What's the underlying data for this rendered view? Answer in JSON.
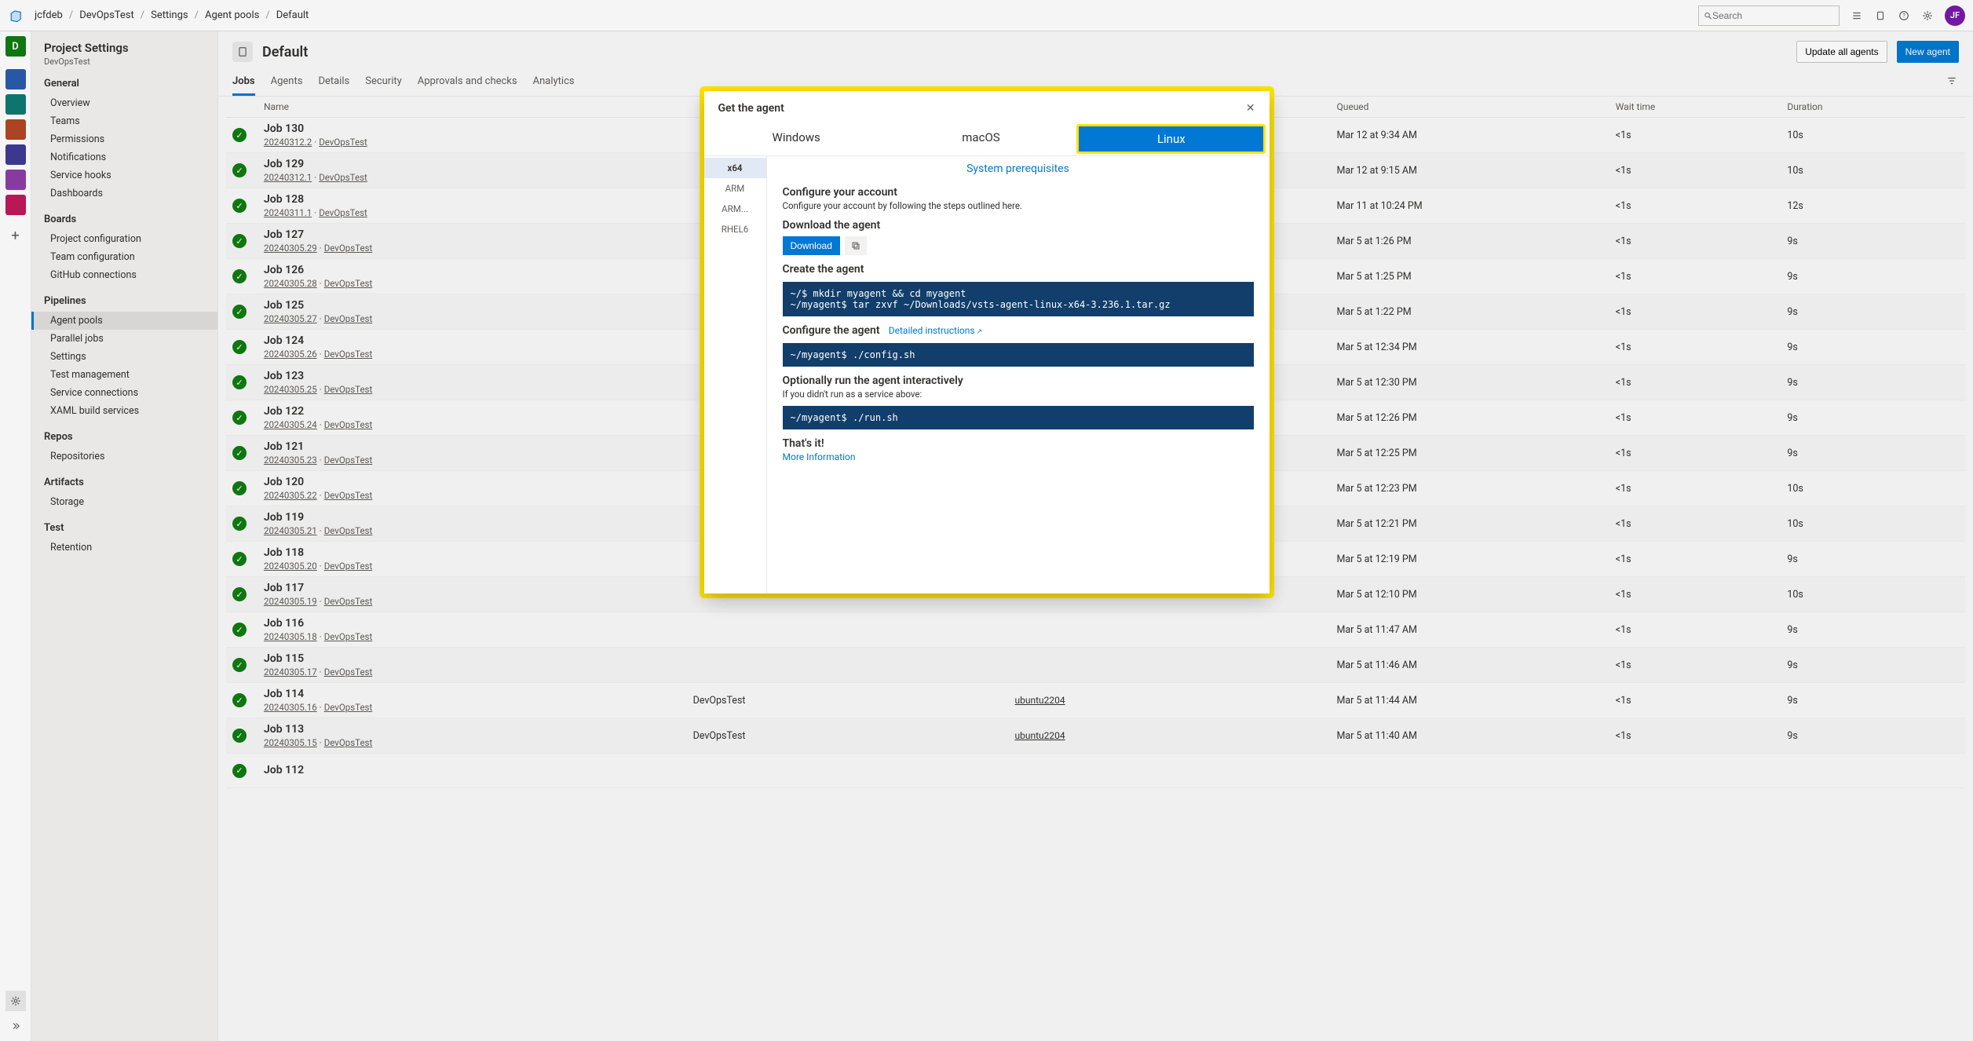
{
  "breadcrumbs": [
    "jcfdeb",
    "DevOpsTest",
    "Settings",
    "Agent pools",
    "Default"
  ],
  "search_placeholder": "Search",
  "avatar_initials": "JF",
  "left_rail_icons": [
    {
      "label": "D",
      "color": "#107c10"
    },
    {
      "label": "",
      "color": "#2a5caa"
    },
    {
      "label": "",
      "color": "#0e7a73"
    },
    {
      "label": "",
      "color": "#b24726"
    },
    {
      "label": "",
      "color": "#3f3b94"
    },
    {
      "label": "",
      "color": "#8e3ea6"
    },
    {
      "label": "",
      "color": "#c2185b"
    }
  ],
  "project_settings_title": "Project Settings",
  "project_settings_sub": "DevOpsTest",
  "sidebar_groups": [
    {
      "label": "General",
      "items": [
        {
          "label": "Overview"
        },
        {
          "label": "Teams"
        },
        {
          "label": "Permissions"
        },
        {
          "label": "Notifications"
        },
        {
          "label": "Service hooks"
        },
        {
          "label": "Dashboards"
        }
      ]
    },
    {
      "label": "Boards",
      "items": [
        {
          "label": "Project configuration"
        },
        {
          "label": "Team configuration"
        },
        {
          "label": "GitHub connections"
        }
      ]
    },
    {
      "label": "Pipelines",
      "items": [
        {
          "label": "Agent pools",
          "active": true
        },
        {
          "label": "Parallel jobs"
        },
        {
          "label": "Settings"
        },
        {
          "label": "Test management"
        },
        {
          "label": "Service connections"
        },
        {
          "label": "XAML build services"
        }
      ]
    },
    {
      "label": "Repos",
      "items": [
        {
          "label": "Repositories"
        }
      ]
    },
    {
      "label": "Artifacts",
      "items": [
        {
          "label": "Storage"
        }
      ]
    },
    {
      "label": "Test",
      "items": [
        {
          "label": "Retention"
        }
      ]
    }
  ],
  "pool_name": "Default",
  "buttons": {
    "update_all": "Update all agents",
    "new_agent": "New agent"
  },
  "tabs": [
    "Jobs",
    "Agents",
    "Details",
    "Security",
    "Approvals and checks",
    "Analytics"
  ],
  "active_tab": "Jobs",
  "columns": [
    "",
    "Name",
    "",
    "",
    "Queued",
    "Wait time",
    "Duration"
  ],
  "jobs": [
    {
      "name": "Job 130",
      "run": "20240312.2",
      "pipeline": "DevOpsTest",
      "project": "",
      "agent": "",
      "queued": "Mar 12 at 9:34 AM",
      "wait": "<1s",
      "duration": "10s"
    },
    {
      "name": "Job 129",
      "run": "20240312.1",
      "pipeline": "DevOpsTest",
      "project": "",
      "agent": "",
      "queued": "Mar 12 at 9:15 AM",
      "wait": "<1s",
      "duration": "10s"
    },
    {
      "name": "Job 128",
      "run": "20240311.1",
      "pipeline": "DevOpsTest",
      "project": "",
      "agent": "",
      "queued": "Mar 11 at 10:24 PM",
      "wait": "<1s",
      "duration": "12s"
    },
    {
      "name": "Job 127",
      "run": "20240305.29",
      "pipeline": "DevOpsTest",
      "project": "",
      "agent": "",
      "queued": "Mar 5 at 1:26 PM",
      "wait": "<1s",
      "duration": "9s"
    },
    {
      "name": "Job 126",
      "run": "20240305.28",
      "pipeline": "DevOpsTest",
      "project": "",
      "agent": "",
      "queued": "Mar 5 at 1:25 PM",
      "wait": "<1s",
      "duration": "9s"
    },
    {
      "name": "Job 125",
      "run": "20240305.27",
      "pipeline": "DevOpsTest",
      "project": "",
      "agent": "",
      "queued": "Mar 5 at 1:22 PM",
      "wait": "<1s",
      "duration": "9s"
    },
    {
      "name": "Job 124",
      "run": "20240305.26",
      "pipeline": "DevOpsTest",
      "project": "",
      "agent": "",
      "queued": "Mar 5 at 12:34 PM",
      "wait": "<1s",
      "duration": "9s"
    },
    {
      "name": "Job 123",
      "run": "20240305.25",
      "pipeline": "DevOpsTest",
      "project": "",
      "agent": "",
      "queued": "Mar 5 at 12:30 PM",
      "wait": "<1s",
      "duration": "9s"
    },
    {
      "name": "Job 122",
      "run": "20240305.24",
      "pipeline": "DevOpsTest",
      "project": "",
      "agent": "",
      "queued": "Mar 5 at 12:26 PM",
      "wait": "<1s",
      "duration": "9s"
    },
    {
      "name": "Job 121",
      "run": "20240305.23",
      "pipeline": "DevOpsTest",
      "project": "",
      "agent": "",
      "queued": "Mar 5 at 12:25 PM",
      "wait": "<1s",
      "duration": "9s"
    },
    {
      "name": "Job 120",
      "run": "20240305.22",
      "pipeline": "DevOpsTest",
      "project": "",
      "agent": "",
      "queued": "Mar 5 at 12:23 PM",
      "wait": "<1s",
      "duration": "10s"
    },
    {
      "name": "Job 119",
      "run": "20240305.21",
      "pipeline": "DevOpsTest",
      "project": "",
      "agent": "",
      "queued": "Mar 5 at 12:21 PM",
      "wait": "<1s",
      "duration": "10s"
    },
    {
      "name": "Job 118",
      "run": "20240305.20",
      "pipeline": "DevOpsTest",
      "project": "",
      "agent": "",
      "queued": "Mar 5 at 12:19 PM",
      "wait": "<1s",
      "duration": "9s"
    },
    {
      "name": "Job 117",
      "run": "20240305.19",
      "pipeline": "DevOpsTest",
      "project": "",
      "agent": "",
      "queued": "Mar 5 at 12:10 PM",
      "wait": "<1s",
      "duration": "10s"
    },
    {
      "name": "Job 116",
      "run": "20240305.18",
      "pipeline": "DevOpsTest",
      "project": "",
      "agent": "",
      "queued": "Mar 5 at 11:47 AM",
      "wait": "<1s",
      "duration": "9s"
    },
    {
      "name": "Job 115",
      "run": "20240305.17",
      "pipeline": "DevOpsTest",
      "project": "",
      "agent": "",
      "queued": "Mar 5 at 11:46 AM",
      "wait": "<1s",
      "duration": "9s"
    },
    {
      "name": "Job 114",
      "run": "20240305.16",
      "pipeline": "DevOpsTest",
      "project": "DevOpsTest",
      "agent": "ubuntu2204",
      "queued": "Mar 5 at 11:44 AM",
      "wait": "<1s",
      "duration": "9s"
    },
    {
      "name": "Job 113",
      "run": "20240305.15",
      "pipeline": "DevOpsTest",
      "project": "DevOpsTest",
      "agent": "ubuntu2204",
      "queued": "Mar 5 at 11:40 AM",
      "wait": "<1s",
      "duration": "9s"
    },
    {
      "name": "Job 112",
      "run": "",
      "pipeline": "",
      "project": "",
      "agent": "",
      "queued": "",
      "wait": "",
      "duration": ""
    }
  ],
  "modal": {
    "title": "Get the agent",
    "os_tabs": [
      "Windows",
      "macOS",
      "Linux"
    ],
    "active_os": "Linux",
    "arch_options": [
      "x64",
      "ARM",
      "ARM...",
      "RHEL6"
    ],
    "active_arch": "x64",
    "sys_prereq": "System prerequisites",
    "config_account_title": "Configure your account",
    "config_account_hint": "Configure your account by following the steps outlined here.",
    "download_title": "Download the agent",
    "download_btn": "Download",
    "create_title": "Create the agent",
    "create_code": "~/$ mkdir myagent && cd myagent\n~/myagent$ tar zxvf ~/Downloads/vsts-agent-linux-x64-3.236.1.tar.gz",
    "configure_title": "Configure the agent",
    "detailed_instructions": "Detailed instructions",
    "configure_code": "~/myagent$ ./config.sh",
    "optional_title": "Optionally run the agent interactively",
    "optional_hint": "If you didn't run as a service above:",
    "optional_code": "~/myagent$ ./run.sh",
    "thats_it": "That's it!",
    "more_info": "More Information"
  }
}
